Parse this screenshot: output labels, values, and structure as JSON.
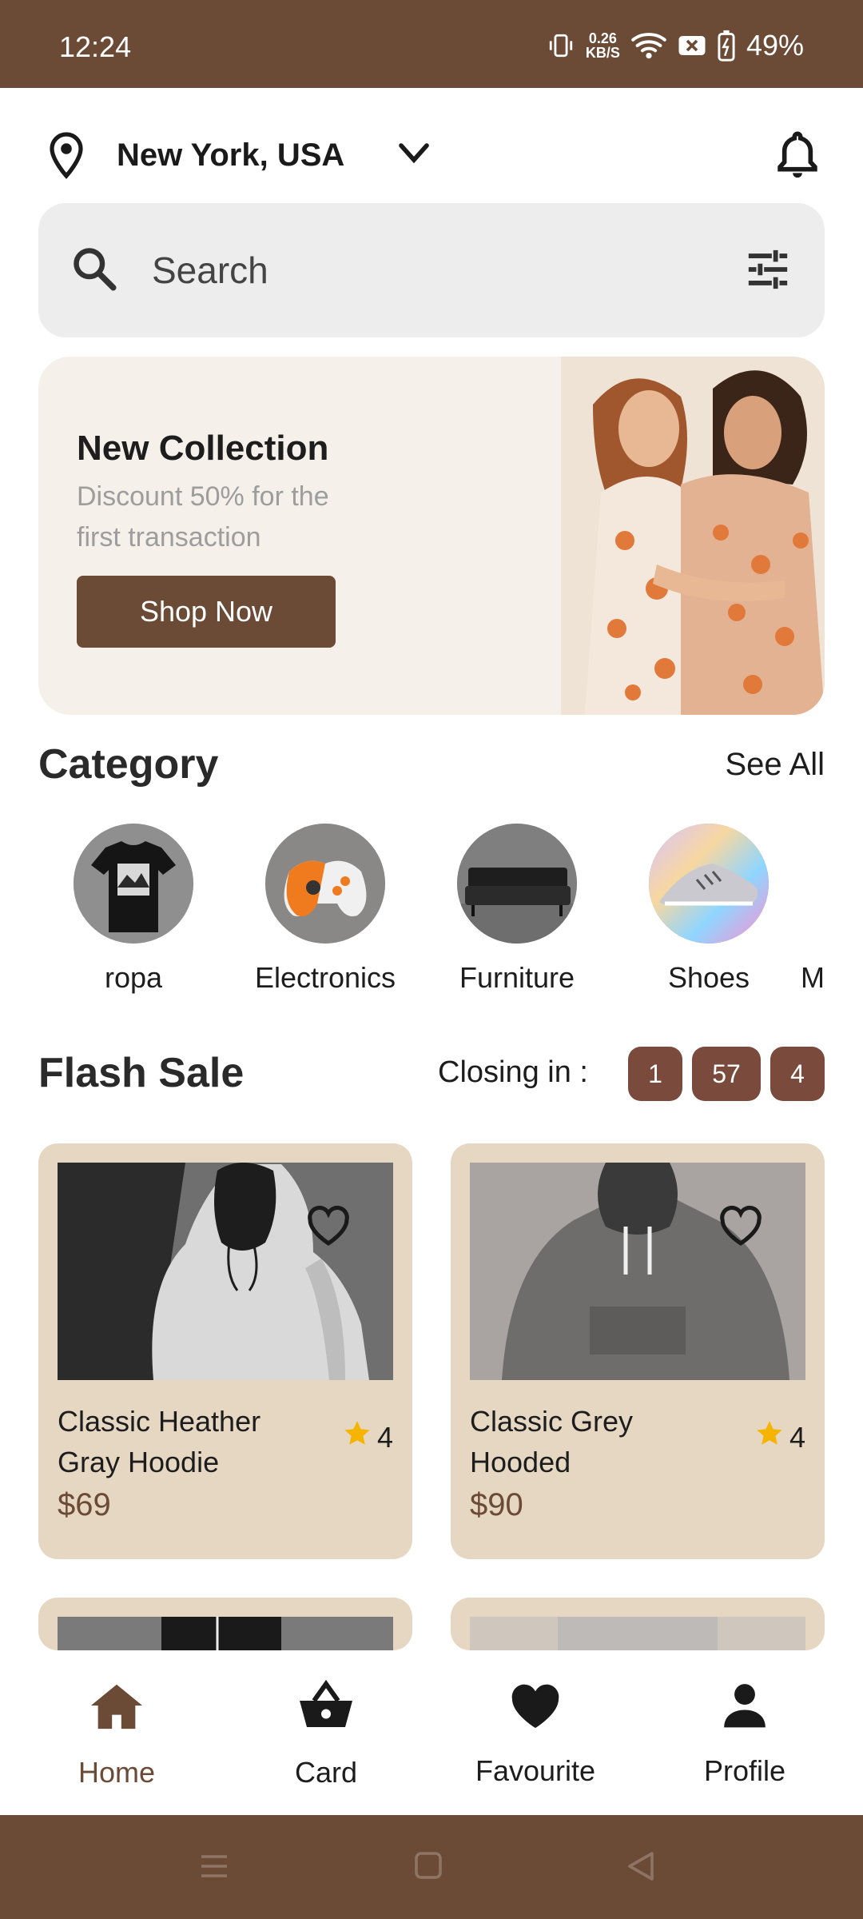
{
  "status_bar": {
    "time": "12:24",
    "net_speed_value": "0.26",
    "net_speed_unit": "KB/S",
    "battery": "49%"
  },
  "header": {
    "location": "New York, USA"
  },
  "search": {
    "placeholder": "Search"
  },
  "banner": {
    "title": "New Collection",
    "subtitle": "Discount 50% for the first transaction",
    "button_label": "Shop Now"
  },
  "category": {
    "title": "Category",
    "see_all": "See All",
    "items": [
      {
        "label": "ropa",
        "icon": "tshirt-icon"
      },
      {
        "label": "Electronics",
        "icon": "gamepad-icon"
      },
      {
        "label": "Furniture",
        "icon": "sofa-icon"
      },
      {
        "label": "Shoes",
        "icon": "sneaker-icon"
      },
      {
        "label": "M",
        "icon": "partial-icon"
      }
    ]
  },
  "flash_sale": {
    "title": "Flash Sale",
    "closing_label": "Closing in :",
    "timer": [
      "1",
      "57",
      "4"
    ]
  },
  "products": [
    {
      "name": "Classic Heather Gray Hoodie",
      "rating": "4",
      "price": "$69"
    },
    {
      "name": "Classic Grey Hooded",
      "rating": "4",
      "price": "$90"
    }
  ],
  "bottom_nav": {
    "items": [
      {
        "label": "Home",
        "icon": "home-icon",
        "active": true
      },
      {
        "label": "Card",
        "icon": "basket-icon",
        "active": false
      },
      {
        "label": "Favourite",
        "icon": "heart-icon",
        "active": false
      },
      {
        "label": "Profile",
        "icon": "person-icon",
        "active": false
      }
    ]
  },
  "colors": {
    "brand": "#6b4a36",
    "card_bg": "#e6d7c3",
    "banner_bg": "#f5f0ea",
    "timer_bg": "#7a4b3c",
    "star": "#f5b400"
  }
}
